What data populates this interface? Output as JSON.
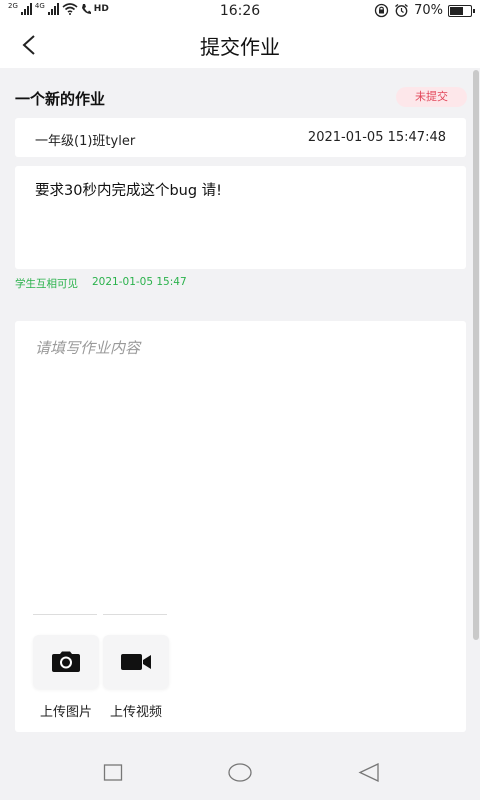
{
  "status_bar": {
    "net1": "2G",
    "net2": "4G",
    "hd": "HD",
    "time": "16:26",
    "battery_text": "70%",
    "battery_level": 0.7
  },
  "header": {
    "title": "提交作业"
  },
  "homework": {
    "title": "一个新的作业",
    "status_badge": "未提交",
    "class_name": "一年级(1)班tyler",
    "assigned_time": "2021-01-05 15:47:48",
    "requirement": "要求30秒内完成这个bug 请!",
    "visibility": "学生互相可见",
    "publish_time": "2021-01-05 15:47"
  },
  "submission": {
    "placeholder": "请填写作业内容",
    "upload_image_label": "上传图片",
    "upload_video_label": "上传视频"
  },
  "colors": {
    "accent_green": "#2bb24c",
    "badge_red": "#e2475a",
    "badge_bg": "#fde7ea"
  }
}
